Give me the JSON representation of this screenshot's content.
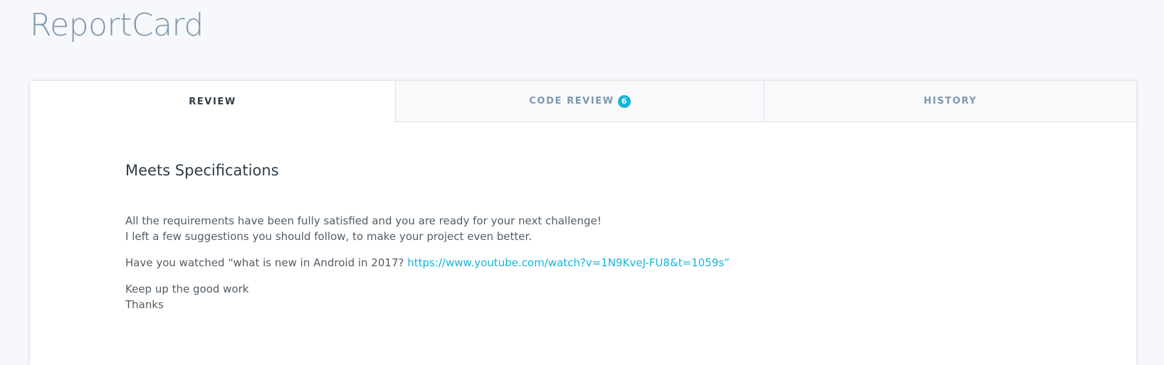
{
  "header": {
    "title": "ReportCard"
  },
  "tabs": [
    {
      "label": "REVIEW",
      "active": true
    },
    {
      "label": "CODE REVIEW",
      "badge": "6",
      "active": false
    },
    {
      "label": "HISTORY",
      "active": false
    }
  ],
  "review": {
    "heading": "Meets Specifications",
    "paragraph1_line1": "All the requirements have been fully satisfied and you are ready for your next challenge!",
    "paragraph1_line2": "I left a few suggestions you should follow, to make your project even better.",
    "paragraph2_prefix": "Have you watched “what is new in Android in 2017? ",
    "paragraph2_link": "https://www.youtube.com/watch?v=1N9KveJ-FU8&t=1059s”",
    "paragraph3_line1": "Keep up the good work",
    "paragraph3_line2": "Thanks"
  },
  "colors": {
    "accent": "#15b4dc",
    "title": "#7d97ad",
    "text": "#525c65",
    "background": "#f7f8fb"
  }
}
